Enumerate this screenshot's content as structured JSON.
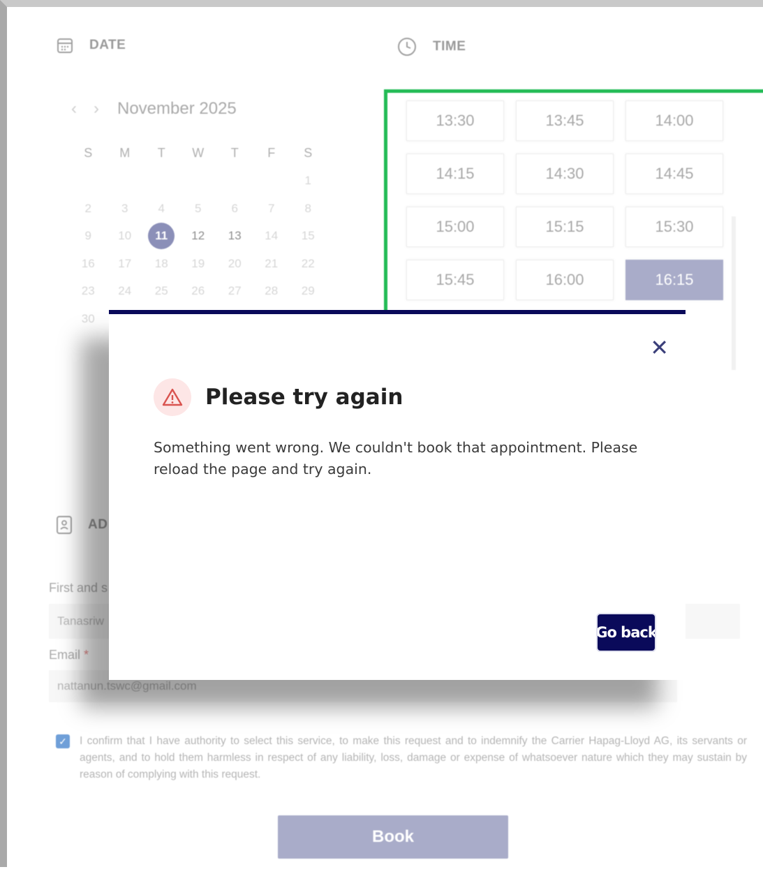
{
  "date_section": {
    "title": "DATE"
  },
  "time_section": {
    "title": "TIME"
  },
  "calendar": {
    "month": "November 2025",
    "weekdays": [
      "S",
      "M",
      "T",
      "W",
      "T",
      "F",
      "S"
    ],
    "weeks": [
      [
        "",
        "",
        "",
        "",
        "",
        "",
        "1"
      ],
      [
        "2",
        "3",
        "4",
        "5",
        "6",
        "7",
        "8"
      ],
      [
        "9",
        "10",
        "11",
        "12",
        "13",
        "14",
        "15"
      ],
      [
        "16",
        "17",
        "18",
        "19",
        "20",
        "21",
        "22"
      ],
      [
        "23",
        "24",
        "25",
        "26",
        "27",
        "28",
        "29"
      ],
      [
        "30",
        "",
        "",
        "",
        "",
        "",
        ""
      ]
    ],
    "selected_day": "11",
    "available_days": [
      "12",
      "13"
    ]
  },
  "time_slots": [
    "13:30",
    "13:45",
    "14:00",
    "14:15",
    "14:30",
    "14:45",
    "15:00",
    "15:15",
    "15:30",
    "15:45",
    "16:00",
    "16:15"
  ],
  "selected_slot": "16:15",
  "attendee_section": {
    "title_partial": "AD"
  },
  "form": {
    "name_label": "First and s",
    "name_value": "Tanasriw",
    "email_label": "Email",
    "email_required": "*",
    "email_value": "nattanun.tswc@gmail.com"
  },
  "consent": {
    "checked": true,
    "text": "I confirm that I have authority to select this service, to make this request and to indemnify the Carrier Hapag-Lloyd AG, its servants or agents, and to hold them harmless in respect of any liability, loss, damage or expense of whatsoever nature which they may sustain by reason of complying with this request."
  },
  "book_button": "Book",
  "dialog": {
    "title": "Please try again",
    "message": "Something went wrong. We couldn't book that appointment. Please reload the page and try again.",
    "go_back": "Go back",
    "close_icon": "close-icon",
    "warning_icon": "warning-icon"
  },
  "colors": {
    "accent_navy": "#0a0a5a",
    "selection": "#a9acc9",
    "highlight_green": "#22bb55",
    "warning_red": "#d9534f"
  }
}
